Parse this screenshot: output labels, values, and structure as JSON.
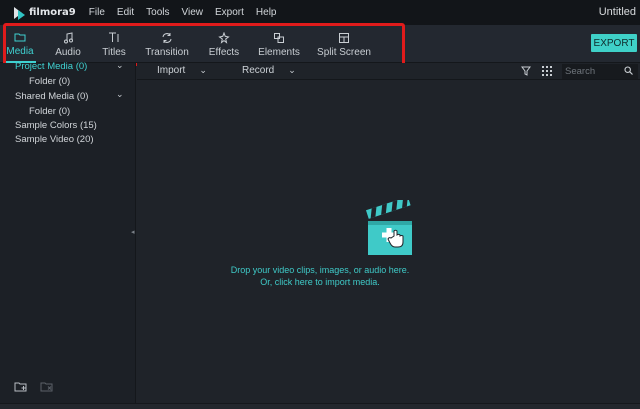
{
  "app": {
    "logo_text": "filmora9",
    "document_title": "Untitled"
  },
  "menu": {
    "items": [
      "File",
      "Edit",
      "Tools",
      "View",
      "Export",
      "Help"
    ]
  },
  "toolbar": {
    "tabs": [
      {
        "label": "Media",
        "icon": "folder-icon",
        "active": true
      },
      {
        "label": "Audio",
        "icon": "music-note-icon",
        "active": false
      },
      {
        "label": "Titles",
        "icon": "text-icon",
        "active": false
      },
      {
        "label": "Transition",
        "icon": "transition-icon",
        "active": false
      },
      {
        "label": "Effects",
        "icon": "sparkle-icon",
        "active": false
      },
      {
        "label": "Elements",
        "icon": "elements-icon",
        "active": false
      },
      {
        "label": "Split Screen",
        "icon": "split-screen-icon",
        "active": false
      }
    ],
    "export_label": "EXPORT"
  },
  "library": {
    "items": [
      {
        "label": "Project Media (0)",
        "expandable": true,
        "indent": 0
      },
      {
        "label": "Folder (0)",
        "expandable": false,
        "indent": 1
      },
      {
        "label": "Shared Media (0)",
        "expandable": true,
        "indent": 0
      },
      {
        "label": "Folder (0)",
        "expandable": false,
        "indent": 1
      },
      {
        "label": "Sample Colors (15)",
        "expandable": false,
        "indent": 0
      },
      {
        "label": "Sample Video (20)",
        "expandable": false,
        "indent": 0
      }
    ]
  },
  "content_toolbar": {
    "import_label": "Import",
    "record_label": "Record",
    "search_placeholder": "Search"
  },
  "drop_zone": {
    "line1": "Drop your video clips, images, or audio here.",
    "line2": "Or, click here to import media."
  },
  "colors": {
    "accent": "#3fd1d1",
    "highlight_box": "#e01b1b",
    "background": "#1f2329"
  }
}
